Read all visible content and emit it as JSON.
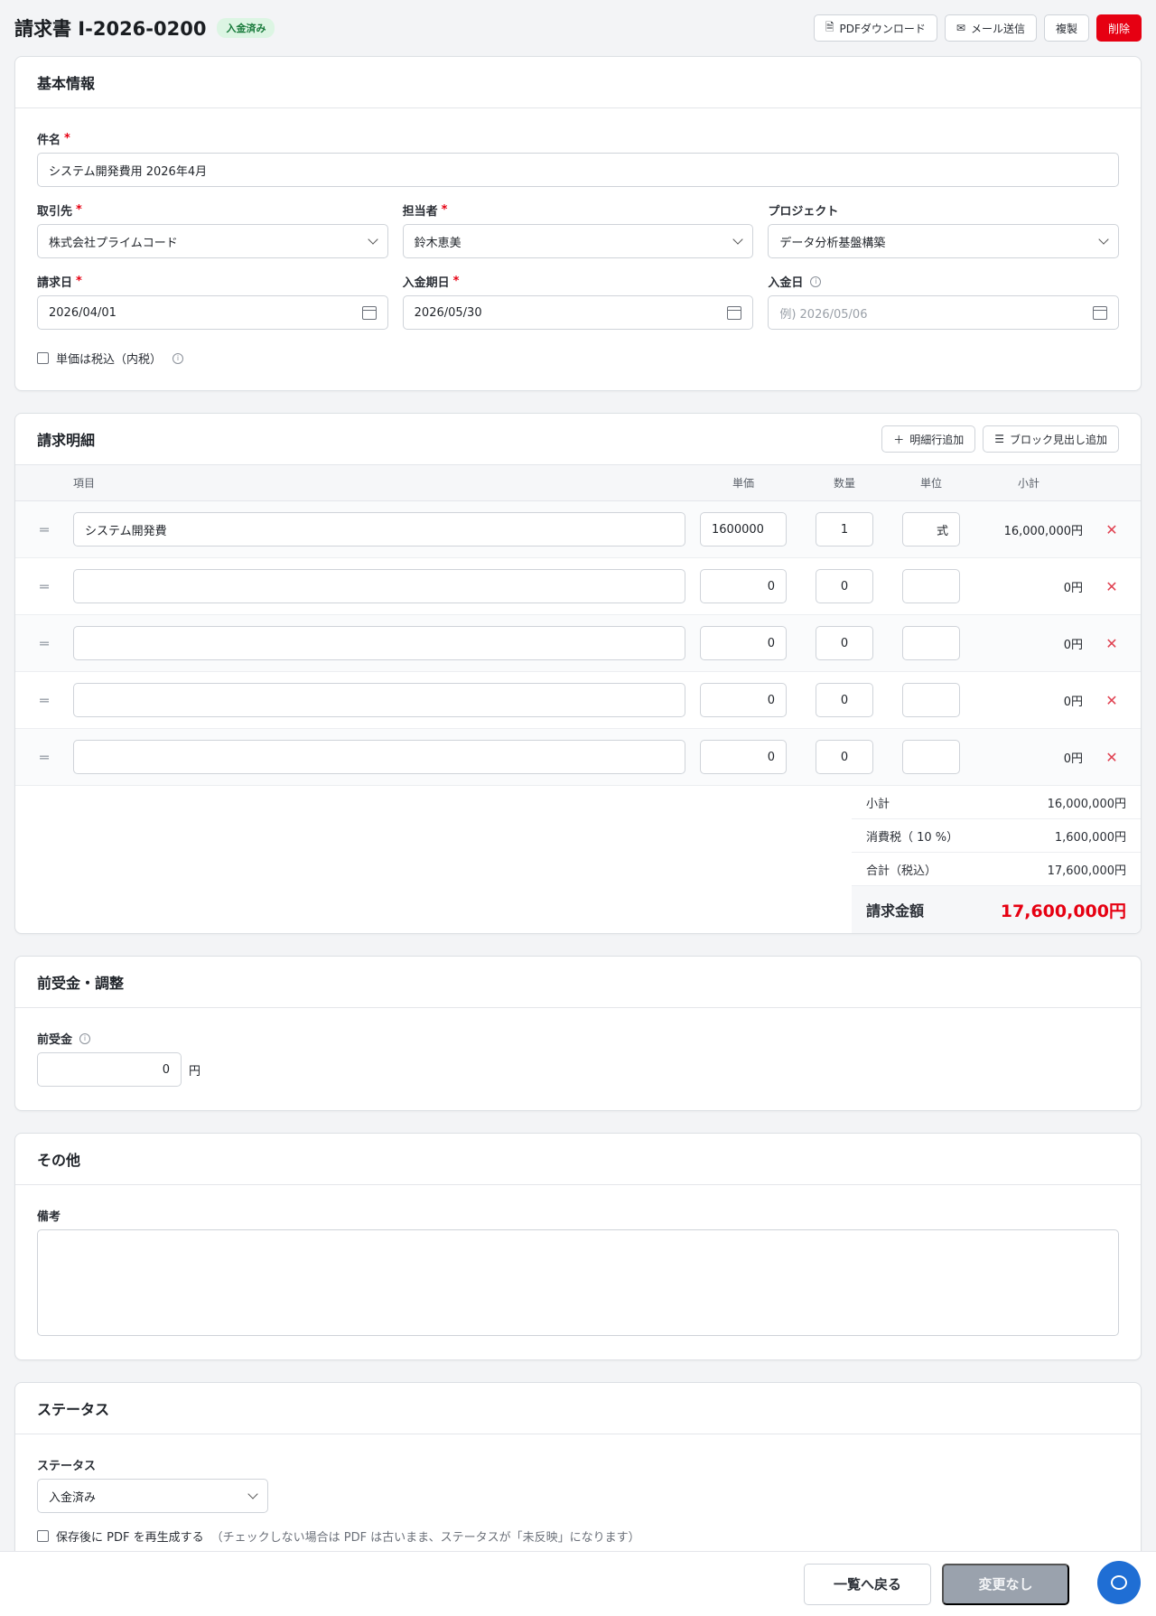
{
  "header": {
    "title": "請求書 I-2026-0200",
    "status_badge": "入金済み",
    "pdf_label": "PDFダウンロード",
    "mail_label": "メール送信",
    "copy_label": "複製",
    "delete_label": "削除"
  },
  "basic": {
    "title": "基本情報",
    "subject_label": "件名",
    "subject_value": "システム開発費用 2026年4月",
    "client_label": "取引先",
    "client_value": "株式会社プライムコード",
    "owner_label": "担当者",
    "owner_value": "鈴木恵美",
    "project_label": "プロジェクト",
    "project_value": "データ分析基盤構築",
    "invoice_date_label": "請求日",
    "invoice_date_value": "2026/04/01",
    "due_date_label": "入金期日",
    "due_date_value": "2026/05/30",
    "paid_date_label": "入金日",
    "paid_date_placeholder": "例) 2026/05/06",
    "tax_included_label": "単価は税込（内税）",
    "required_mark": "*"
  },
  "lines": {
    "title": "請求明細",
    "add_line_label": "明細行追加",
    "add_block_label": "ブロック見出し追加",
    "columns": [
      "項目",
      "単価",
      "数量",
      "単位",
      "小計"
    ],
    "rows": [
      {
        "item": "システム開発費",
        "price": "1600000",
        "qty": "1",
        "unit": "式",
        "subtotal": "16,000,000円"
      },
      {
        "item": "",
        "price": "0",
        "qty": "0",
        "unit": "",
        "subtotal": "0円"
      },
      {
        "item": "",
        "price": "0",
        "qty": "0",
        "unit": "",
        "subtotal": "0円"
      },
      {
        "item": "",
        "price": "0",
        "qty": "0",
        "unit": "",
        "subtotal": "0円"
      },
      {
        "item": "",
        "price": "0",
        "qty": "0",
        "unit": "",
        "subtotal": "0円"
      }
    ],
    "totals": {
      "subtotal_label": "小計",
      "subtotal_value": "16,000,000円",
      "tax_label": "消費税（ 10 %）",
      "tax_value": "1,600,000円",
      "total_label": "合計（税込）",
      "total_value": "17,600,000円",
      "grand_label": "請求金額",
      "grand_value": "17,600,000円"
    }
  },
  "advance": {
    "title": "前受金・調整",
    "label": "前受金",
    "value": "0",
    "unit": "円"
  },
  "other": {
    "title": "その他",
    "notes_label": "備考"
  },
  "status": {
    "title": "ステータス",
    "label": "ステータス",
    "value": "入金済み",
    "regen_label": "保存後に PDF を再生成する",
    "regen_note": "（チェックしない場合は PDF は古いまま、ステータスが「未反映」になります）"
  },
  "footer": {
    "back_label": "一覧へ戻る",
    "nochange_label": "変更なし"
  },
  "colors": {
    "accent": "#1f6ed4",
    "danger": "#e60012",
    "badge_bg": "#dcf5e3"
  }
}
